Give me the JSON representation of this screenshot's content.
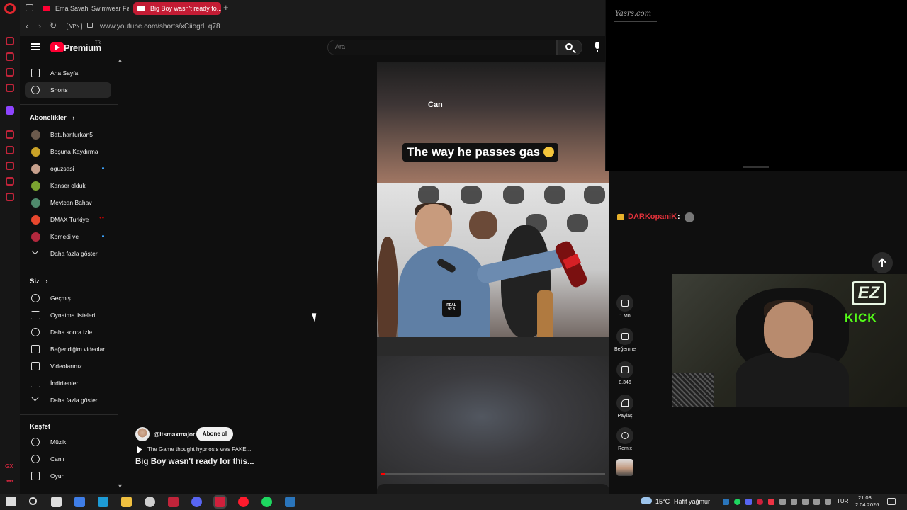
{
  "browser": {
    "tabs": [
      {
        "label": "Ema Savahl Swimwear Fa..."
      },
      {
        "label": "Big Boy wasn't ready fo..."
      }
    ],
    "new_tab": "+",
    "vpn": "VPN",
    "url": "www.youtube.com/shorts/xCiiogdLq78"
  },
  "youtube": {
    "brand": "Premium",
    "region": "TR",
    "search_placeholder": "Ara"
  },
  "sidebar": {
    "main": [
      {
        "label": "Ana Sayfa",
        "icon": "home-icon"
      },
      {
        "label": "Shorts",
        "icon": "shorts-icon",
        "active": true
      }
    ],
    "subscriptions_header": "Abonelikler",
    "subscriptions": [
      {
        "label": "Batuhanfurkan5",
        "avatar_color": "#6b5a4c"
      },
      {
        "label": "Boşuna Kaydırma",
        "avatar_color": "#c9a227"
      },
      {
        "label": "oguzsasi",
        "avatar_color": "#c7a08c",
        "new": true
      },
      {
        "label": "Kanser olduk",
        "avatar_color": "#7aa330"
      },
      {
        "label": "Mevtcan Bahav",
        "avatar_color": "#4f8a6c"
      },
      {
        "label": "DMAX Turkiye",
        "avatar_color": "#e8472d",
        "live": true
      },
      {
        "label": "Komedi ve",
        "avatar_color": "#b2283d",
        "new": true
      }
    ],
    "subs_more": "Daha fazla göster",
    "you_header": "Siz",
    "you": [
      {
        "label": "Geçmiş",
        "icon": "history-icon"
      },
      {
        "label": "Oynatma listeleri",
        "icon": "playlists-icon"
      },
      {
        "label": "Daha sonra izle",
        "icon": "watch-later-icon"
      },
      {
        "label": "Beğendiğim videolar",
        "icon": "liked-videos-icon"
      },
      {
        "label": "Videolarınız",
        "icon": "your-videos-icon"
      },
      {
        "label": "İndirilenler",
        "icon": "downloads-icon"
      }
    ],
    "you_more": "Daha fazla göster",
    "explore_header": "Keşfet",
    "explore": [
      {
        "label": "Müzik",
        "icon": "music-icon"
      },
      {
        "label": "Canlı",
        "icon": "live-icon"
      },
      {
        "label": "Oyun",
        "icon": "gaming-icon"
      }
    ]
  },
  "short": {
    "caption_top": "Can",
    "caption_main": "The way he passes gas",
    "mic_flag": "REAL 92.3",
    "channel": "@itsmaxmajor",
    "subscribe": "Abone ol",
    "source": "The Game thought hypnosis was FAKE...",
    "title": "Big Boy wasn't ready for this...",
    "progress": 0.02
  },
  "actions": [
    {
      "name": "like",
      "label": "1 Mn",
      "icon": "thumbs-up-icon"
    },
    {
      "name": "dislike",
      "label": "Beğenme",
      "icon": "thumbs-down-icon"
    },
    {
      "name": "comments",
      "label": "8.346",
      "icon": "comment-icon"
    },
    {
      "name": "share",
      "label": "Paylaş",
      "icon": "share-icon"
    },
    {
      "name": "remix",
      "label": "Remix",
      "icon": "remix-icon"
    }
  ],
  "stream": {
    "overlay_title": "Yasrs.com",
    "chat_user": "DARKopaniK",
    "chat_colon": ":",
    "neon_ez": "EZ",
    "neon_kick": "KICK"
  },
  "taskbar": {
    "temp": "15°C",
    "weather": "Hafif yağmur",
    "lang": "TUR",
    "time": "21:03",
    "date": "2.04.2026",
    "apps": [
      {
        "icon": "task-view-icon",
        "color": "#ddd"
      },
      {
        "icon": "copilot-icon",
        "color": "#3f7ee8"
      },
      {
        "icon": "edge-icon",
        "color": "#1d9bd6"
      },
      {
        "icon": "file-explorer-icon",
        "color": "#f0c040"
      },
      {
        "icon": "obs-icon",
        "color": "#cfcfcf"
      },
      {
        "icon": "voicemod-icon",
        "color": "#c0243a"
      },
      {
        "icon": "discord-icon",
        "color": "#5865f2"
      },
      {
        "icon": "opera-gx-icon",
        "color": "#d0203c"
      },
      {
        "icon": "opera-icon",
        "color": "#ff1b2d"
      },
      {
        "icon": "spotify-icon",
        "color": "#1ed760"
      },
      {
        "icon": "steam-icon",
        "color": "#2a75bb"
      }
    ]
  }
}
